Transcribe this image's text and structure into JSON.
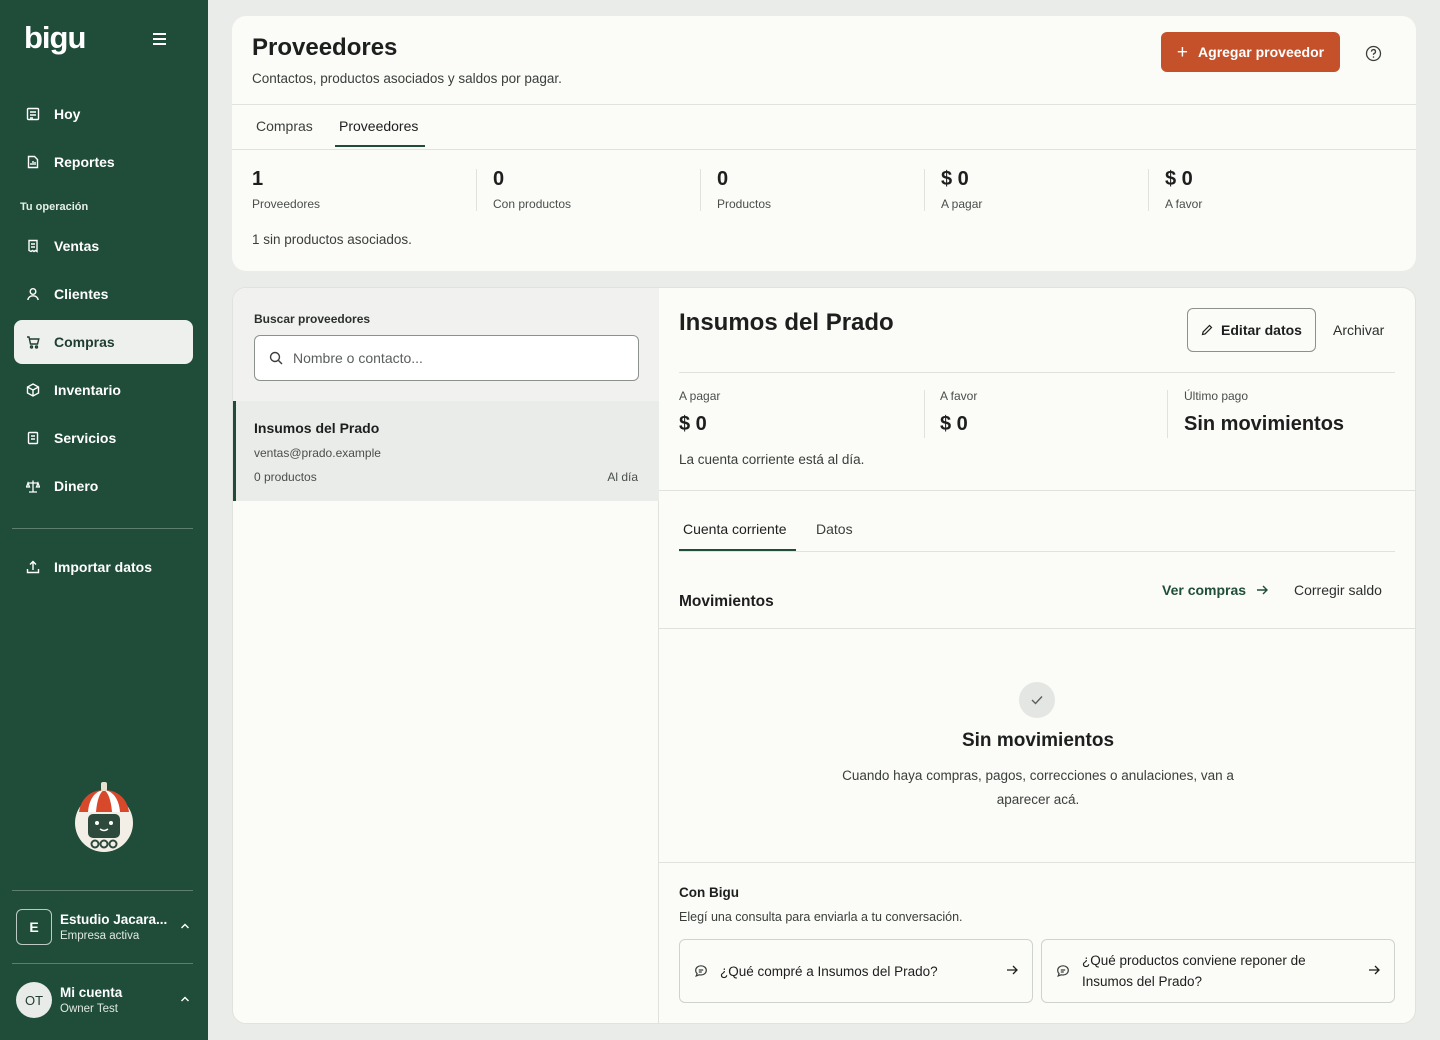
{
  "brand": {
    "logo": "bigu",
    "accent": "#c4512a",
    "sidebar_bg": "#1f4d3a"
  },
  "sidebar": {
    "menu_icon": "hamburger-icon",
    "top_items": [
      {
        "label": "Hoy",
        "icon": "calendar-icon"
      },
      {
        "label": "Reportes",
        "icon": "report-icon"
      }
    ],
    "section_label": "Tu operación",
    "items": [
      {
        "label": "Ventas",
        "icon": "receipt-icon"
      },
      {
        "label": "Clientes",
        "icon": "user-icon"
      },
      {
        "label": "Compras",
        "icon": "cart-icon",
        "active": true
      },
      {
        "label": "Inventario",
        "icon": "box-icon"
      },
      {
        "label": "Servicios",
        "icon": "document-icon"
      },
      {
        "label": "Dinero",
        "icon": "scale-icon"
      }
    ],
    "import": {
      "label": "Importar datos",
      "icon": "upload-icon"
    },
    "company": {
      "initial": "E",
      "name": "Estudio Jacara...",
      "status": "Empresa activa"
    },
    "account": {
      "initials": "OT",
      "title": "Mi cuenta",
      "user": "Owner Test"
    }
  },
  "header": {
    "title": "Proveedores",
    "subtitle": "Contactos, productos asociados y saldos por pagar.",
    "add_button": "Agregar proveedor",
    "tabs": [
      "Compras",
      "Proveedores"
    ],
    "active_tab": "Proveedores"
  },
  "stats": [
    {
      "value": "1",
      "label": "Proveedores"
    },
    {
      "value": "0",
      "label": "Con productos"
    },
    {
      "value": "0",
      "label": "Productos"
    },
    {
      "value": "$ 0",
      "label": "A pagar"
    },
    {
      "value": "$ 0",
      "label": "A favor"
    }
  ],
  "stats_note": "1 sin productos asociados.",
  "search": {
    "label": "Buscar proveedores",
    "placeholder": "Nombre o contacto...",
    "value": ""
  },
  "providers": [
    {
      "name": "Insumos del Prado",
      "email": "ventas@prado.example",
      "products": "0 productos",
      "status": "Al día"
    }
  ],
  "detail": {
    "name": "Insumos del Prado",
    "edit_button": "Editar datos",
    "archive_button": "Archivar",
    "balances": [
      {
        "label": "A pagar",
        "value": "$ 0"
      },
      {
        "label": "A favor",
        "value": "$ 0"
      },
      {
        "label": "Último pago",
        "value": "Sin movimientos"
      }
    ],
    "balance_note": "La cuenta corriente está al día.",
    "tabs": [
      "Cuenta corriente",
      "Datos"
    ],
    "active_tab": "Cuenta corriente",
    "movements_title": "Movimientos",
    "ver_compras": "Ver compras",
    "corregir_saldo": "Corregir saldo",
    "empty_title": "Sin movimientos",
    "empty_desc": "Cuando haya compras, pagos, correcciones o anulaciones, van a aparecer acá."
  },
  "assistant": {
    "title": "Con Bigu",
    "subtitle": "Elegí una consulta para enviarla a tu conversación.",
    "questions": [
      "¿Qué compré a Insumos del Prado?",
      "¿Qué productos conviene reponer de Insumos del Prado?"
    ]
  }
}
